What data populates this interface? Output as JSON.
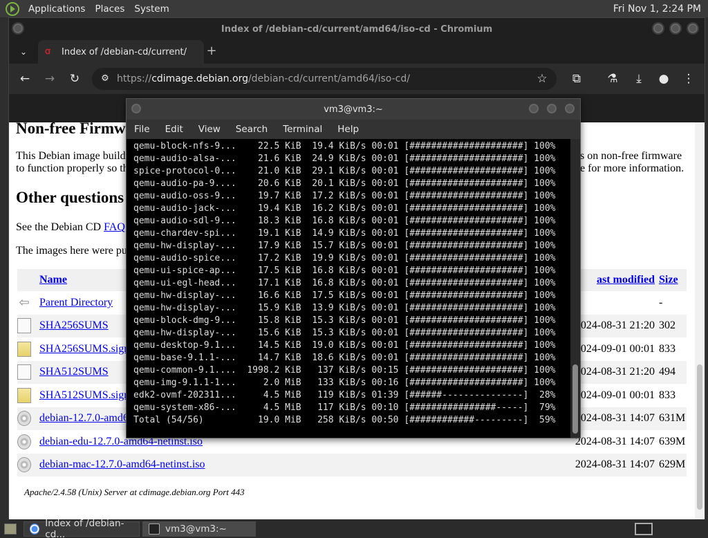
{
  "topbar": {
    "menus": [
      "Applications",
      "Places",
      "System"
    ],
    "clock": "Fri Nov 1,  2:24 PM"
  },
  "browser": {
    "window_title": "Index of /debian-cd/current/amd64/iso-cd - Chromium",
    "tab_title": "Index of /debian-cd/current/",
    "url_scheme": "https://",
    "url_host": "cdimage.debian.org",
    "url_path": "/debian-cd/current/amd64/iso-cd/"
  },
  "page": {
    "heading_nonfree": "Non-free Firmw",
    "para1_line1_left": "This Debian image build",
    "para1_line2_left": "to function properly so th",
    "para1_line1_right": "s on non-free firmware",
    "para1_line2_right": "e for more information.",
    "heading_other": "Other questions",
    "faq_prefix": "See the Debian CD ",
    "faq_link": "FAQ",
    "images_text": "The images here were pu",
    "columns": {
      "name": "Name",
      "last_modified": "ast modified",
      "size": "Size"
    },
    "rows": [
      {
        "icon": "back",
        "name": "Parent Directory",
        "modified": "",
        "size": "-"
      },
      {
        "icon": "file",
        "name": "SHA256SUMS",
        "modified": "2024-08-31 21:20",
        "size": "302"
      },
      {
        "icon": "sig",
        "name": "SHA256SUMS.sign",
        "modified": "2024-09-01 00:01",
        "size": "833"
      },
      {
        "icon": "file",
        "name": "SHA512SUMS",
        "modified": "2024-08-31 21:20",
        "size": "494"
      },
      {
        "icon": "sig",
        "name": "SHA512SUMS.sign",
        "modified": "2024-09-01 00:01",
        "size": "833"
      },
      {
        "icon": "disc",
        "name": "debian-12.7.0-amd6",
        "modified": "2024-08-31 14:07",
        "size": "631M"
      },
      {
        "icon": "disc",
        "name": "debian-edu-12.7.0-amd64-netinst.iso",
        "modified": "2024-08-31 14:07",
        "size": "639M"
      },
      {
        "icon": "disc",
        "name": "debian-mac-12.7.0-amd64-netinst.iso",
        "modified": "2024-08-31 14:07",
        "size": "629M"
      }
    ],
    "footer": "Apache/2.4.58 (Unix) Server at cdimage.debian.org Port 443"
  },
  "terminal": {
    "title": "vm3@vm3:~",
    "menus": [
      "File",
      "Edit",
      "View",
      "Search",
      "Terminal",
      "Help"
    ],
    "lines": [
      "qemu-block-nfs-9...    22.5 KiB  19.4 KiB/s 00:01 [#####################] 100%",
      "qemu-audio-alsa-...    21.6 KiB  24.9 KiB/s 00:01 [#####################] 100%",
      "spice-protocol-0...    21.0 KiB  29.1 KiB/s 00:01 [#####################] 100%",
      "qemu-audio-pa-9....    20.6 KiB  20.1 KiB/s 00:01 [#####################] 100%",
      "qemu-audio-oss-9...    19.7 KiB  17.2 KiB/s 00:01 [#####################] 100%",
      "qemu-audio-jack-...    19.4 KiB  16.2 KiB/s 00:01 [#####################] 100%",
      "qemu-audio-sdl-9...    18.3 KiB  16.8 KiB/s 00:01 [#####################] 100%",
      "qemu-chardev-spi...    19.1 KiB  14.9 KiB/s 00:01 [#####################] 100%",
      "qemu-hw-display-...    17.9 KiB  15.7 KiB/s 00:01 [#####################] 100%",
      "qemu-audio-spice...    17.2 KiB  19.9 KiB/s 00:01 [#####################] 100%",
      "qemu-ui-spice-ap...    17.5 KiB  16.8 KiB/s 00:01 [#####################] 100%",
      "qemu-ui-egl-head...    17.1 KiB  16.8 KiB/s 00:01 [#####################] 100%",
      "qemu-hw-display-...    16.6 KiB  17.5 KiB/s 00:01 [#####################] 100%",
      "qemu-hw-display-...    15.9 KiB  13.9 KiB/s 00:01 [#####################] 100%",
      "qemu-block-dmg-9...    15.8 KiB  15.3 KiB/s 00:01 [#####################] 100%",
      "qemu-hw-display-...    15.6 KiB  15.3 KiB/s 00:01 [#####################] 100%",
      "qemu-desktop-9.1...    14.5 KiB  19.0 KiB/s 00:01 [#####################] 100%",
      "qemu-base-9.1.1-...    14.7 KiB  18.6 KiB/s 00:01 [#####################] 100%",
      "qemu-common-9.1....  1998.2 KiB   137 KiB/s 00:15 [#####################] 100%",
      "qemu-img-9.1.1-1...     2.0 MiB   133 KiB/s 00:16 [#####################] 100%",
      "edk2-ovmf-202311...     4.5 MiB   119 KiB/s 01:39 [######---------------]  28%",
      "qemu-system-x86-...     4.5 MiB   117 KiB/s 00:10 [################-----]  79%",
      "Total (54/56)          19.0 MiB   258 KiB/s 00:50 [############---------]  59%"
    ]
  },
  "taskbar": {
    "items": [
      "Index of /debian-cd...",
      "vm3@vm3:~"
    ]
  }
}
